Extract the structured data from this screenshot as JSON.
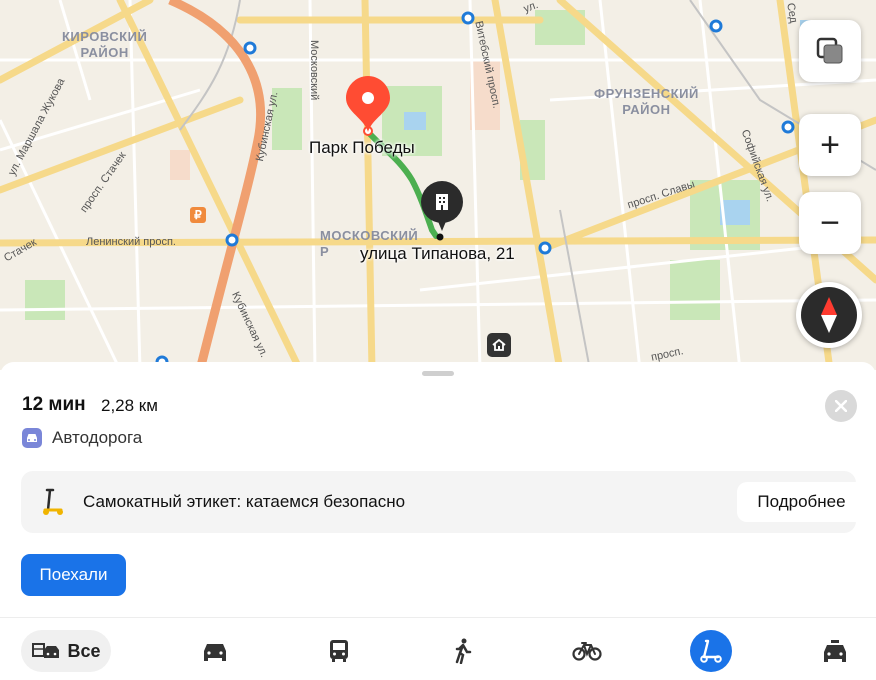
{
  "map": {
    "districts": [
      {
        "id": "kirovsky",
        "text": "КИРОВСКИЙ\nРАЙОН"
      },
      {
        "id": "frunzensky",
        "text": "ФРУНЗЕНСКИЙ\nРАЙОН"
      },
      {
        "id": "moskovsky",
        "text": "МОСКОВСКИЙ\nР"
      }
    ],
    "streets": {
      "moskovsky": "Московский",
      "vitebsky": "Витебский просп.",
      "kubinskaya_top": "Кубинская ул.",
      "kubinskaya_bottom": "Кубинская ул.",
      "zhukova": "ул. Маршала Жукова",
      "stachek": "просп. Стачек",
      "stachek_left": "Стачек",
      "leninsky": "Ленинский просп.",
      "slavy": "просп. Славы",
      "sofiyskaya": "Софийская ул.",
      "prosp_bottom": "просп.",
      "ul_top": "ул.",
      "sed": "Сед"
    },
    "poi_start": "Парк Победы",
    "poi_end": "улица Типанова, 21",
    "colors": {
      "route": "#4caf50",
      "pin": "#ff4c33",
      "building_pin": "#2b2b2b"
    }
  },
  "controls": {
    "layers": "layers-icon",
    "zoom_in": "+",
    "zoom_out": "−",
    "compass": "compass-icon"
  },
  "route": {
    "time": "12 мин",
    "distance": "2,28 км",
    "road_type": "Автодорога"
  },
  "promo": {
    "text": "Самокатный этикет: катаемся безопасно",
    "button": "Подробнее"
  },
  "go_button": "Поехали",
  "modes": {
    "all_label": "Все",
    "items": [
      "car",
      "bus",
      "pedestrian",
      "bicycle",
      "scooter",
      "taxi"
    ],
    "active": "scooter",
    "accent": "#1a73e8"
  }
}
